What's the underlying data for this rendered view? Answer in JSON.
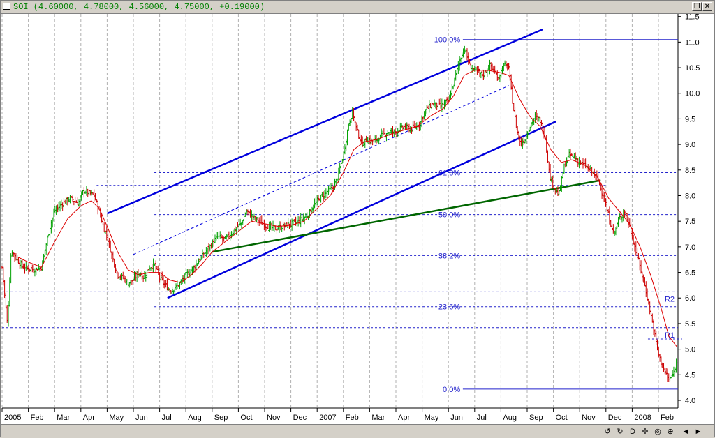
{
  "window": {
    "title": "SOI (4.60000, 4.78000, 4.56000, 4.75000, +0.19000)",
    "buttons": [
      "restore-icon",
      "close-icon"
    ]
  },
  "colors": {
    "price": "#00a000",
    "price_down": "#cc0000",
    "ma": "#dd0000",
    "channel": "#0000dd",
    "trendline": "#006600",
    "fib": "#2222cc",
    "grid": "#b0b0b0"
  },
  "navbar": {
    "buttons": [
      "scroll-left-end-icon",
      "zoom-out-icon",
      "date-mode-icon",
      "pan-icon",
      "zoom-reset-icon",
      "zoom-in-icon",
      "scroll-left-icon",
      "scroll-right-icon"
    ],
    "glyphs": [
      "↺",
      "↻",
      "D",
      "✛",
      "◎",
      "⊕",
      "◄",
      "►"
    ]
  },
  "chart_data": {
    "type": "candlestick",
    "ylim": [
      3.85,
      11.55
    ],
    "yticks": [
      "11.5",
      "11.0",
      "10.5",
      "10.0",
      "9.5",
      "9.0",
      "8.5",
      "8.0",
      "7.5",
      "7.0",
      "6.5",
      "6.0",
      "5.5",
      "5.0",
      "4.5",
      "4.0"
    ],
    "yticks_values": [
      11.5,
      11.0,
      10.5,
      10.0,
      9.5,
      9.0,
      8.5,
      8.0,
      7.5,
      7.0,
      6.5,
      6.0,
      5.5,
      5.0,
      4.5,
      4.0
    ],
    "xticks": [
      "2005",
      "Feb",
      "Mar",
      "Apr",
      "May",
      "Jun",
      "Jul",
      "Aug",
      "Sep",
      "Oct",
      "Nov",
      "Dec",
      "2007",
      "Feb",
      "Mar",
      "Apr",
      "May",
      "Jun",
      "Jul",
      "Aug",
      "Sep",
      "Oct",
      "Nov",
      "Dec",
      "2008",
      "Feb"
    ],
    "xticks_month_index": [
      0,
      1,
      2,
      3,
      4,
      5,
      6,
      7,
      8,
      9,
      10,
      11,
      12,
      13,
      14,
      15,
      16,
      17,
      18,
      19,
      20,
      21,
      22,
      23,
      24,
      25
    ],
    "last_bar": {
      "open": 4.6,
      "high": 4.78,
      "low": 4.56,
      "close": 4.75,
      "change": 0.19
    },
    "price_path": [
      [
        0.0,
        6.6
      ],
      [
        0.2,
        5.5
      ],
      [
        0.35,
        6.95
      ],
      [
        0.5,
        6.8
      ],
      [
        0.8,
        6.6
      ],
      [
        1.2,
        6.55
      ],
      [
        1.5,
        6.6
      ],
      [
        1.8,
        7.35
      ],
      [
        2.0,
        7.7
      ],
      [
        2.3,
        7.85
      ],
      [
        2.6,
        7.95
      ],
      [
        2.9,
        7.85
      ],
      [
        3.1,
        8.1
      ],
      [
        3.3,
        8.05
      ],
      [
        3.5,
        8.0
      ],
      [
        3.7,
        7.7
      ],
      [
        3.85,
        7.4
      ],
      [
        4.0,
        7.2
      ],
      [
        4.2,
        6.8
      ],
      [
        4.4,
        6.45
      ],
      [
        4.6,
        6.4
      ],
      [
        4.8,
        6.3
      ],
      [
        5.0,
        6.35
      ],
      [
        5.2,
        6.5
      ],
      [
        5.4,
        6.4
      ],
      [
        5.6,
        6.6
      ],
      [
        5.8,
        6.65
      ],
      [
        6.0,
        6.4
      ],
      [
        6.2,
        6.25
      ],
      [
        6.4,
        6.15
      ],
      [
        6.6,
        6.2
      ],
      [
        6.8,
        6.3
      ],
      [
        7.0,
        6.45
      ],
      [
        7.3,
        6.6
      ],
      [
        7.6,
        6.8
      ],
      [
        7.9,
        7.0
      ],
      [
        8.2,
        7.2
      ],
      [
        8.5,
        7.15
      ],
      [
        8.8,
        7.3
      ],
      [
        9.1,
        7.45
      ],
      [
        9.3,
        7.7
      ],
      [
        9.5,
        7.6
      ],
      [
        9.8,
        7.5
      ],
      [
        10.1,
        7.4
      ],
      [
        10.4,
        7.35
      ],
      [
        10.7,
        7.4
      ],
      [
        11.0,
        7.45
      ],
      [
        11.3,
        7.5
      ],
      [
        11.6,
        7.6
      ],
      [
        12.0,
        7.9
      ],
      [
        12.3,
        8.05
      ],
      [
        12.6,
        8.15
      ],
      [
        12.8,
        8.4
      ],
      [
        13.0,
        8.8
      ],
      [
        13.2,
        9.4
      ],
      [
        13.35,
        9.65
      ],
      [
        13.5,
        9.3
      ],
      [
        13.7,
        9.0
      ],
      [
        13.9,
        9.1
      ],
      [
        14.1,
        9.05
      ],
      [
        14.4,
        9.15
      ],
      [
        14.7,
        9.25
      ],
      [
        15.0,
        9.25
      ],
      [
        15.3,
        9.35
      ],
      [
        15.6,
        9.3
      ],
      [
        15.9,
        9.4
      ],
      [
        16.1,
        9.65
      ],
      [
        16.4,
        9.8
      ],
      [
        16.7,
        9.75
      ],
      [
        17.0,
        9.85
      ],
      [
        17.2,
        10.2
      ],
      [
        17.4,
        10.6
      ],
      [
        17.6,
        10.9
      ],
      [
        17.8,
        10.55
      ],
      [
        18.0,
        10.45
      ],
      [
        18.3,
        10.35
      ],
      [
        18.6,
        10.55
      ],
      [
        18.9,
        10.3
      ],
      [
        19.1,
        10.55
      ],
      [
        19.3,
        10.5
      ],
      [
        19.45,
        9.8
      ],
      [
        19.6,
        9.3
      ],
      [
        19.75,
        9.0
      ],
      [
        19.9,
        9.1
      ],
      [
        20.1,
        9.35
      ],
      [
        20.3,
        9.55
      ],
      [
        20.5,
        9.45
      ],
      [
        20.7,
        9.1
      ],
      [
        20.85,
        8.4
      ],
      [
        21.0,
        8.2
      ],
      [
        21.2,
        8.0
      ],
      [
        21.4,
        8.55
      ],
      [
        21.6,
        8.8
      ],
      [
        21.8,
        8.75
      ],
      [
        22.0,
        8.65
      ],
      [
        22.3,
        8.55
      ],
      [
        22.5,
        8.45
      ],
      [
        22.7,
        8.3
      ],
      [
        22.9,
        8.0
      ],
      [
        23.1,
        7.6
      ],
      [
        23.3,
        7.25
      ],
      [
        23.5,
        7.55
      ],
      [
        23.7,
        7.7
      ],
      [
        23.9,
        7.4
      ],
      [
        24.1,
        7.0
      ],
      [
        24.3,
        6.6
      ],
      [
        24.5,
        6.2
      ],
      [
        24.7,
        5.7
      ],
      [
        24.85,
        5.3
      ],
      [
        25.0,
        4.9
      ],
      [
        25.2,
        4.6
      ],
      [
        25.4,
        4.4
      ],
      [
        25.55,
        4.5
      ],
      [
        25.7,
        4.75
      ]
    ],
    "ma_path": [
      [
        0.6,
        6.8
      ],
      [
        1.0,
        6.7
      ],
      [
        1.5,
        6.6
      ],
      [
        2.0,
        7.1
      ],
      [
        2.5,
        7.55
      ],
      [
        3.0,
        7.8
      ],
      [
        3.4,
        7.9
      ],
      [
        3.7,
        7.75
      ],
      [
        4.0,
        7.4
      ],
      [
        4.4,
        6.9
      ],
      [
        4.8,
        6.55
      ],
      [
        5.2,
        6.45
      ],
      [
        5.6,
        6.5
      ],
      [
        6.0,
        6.5
      ],
      [
        6.4,
        6.35
      ],
      [
        6.8,
        6.3
      ],
      [
        7.2,
        6.45
      ],
      [
        7.6,
        6.65
      ],
      [
        8.0,
        6.9
      ],
      [
        8.5,
        7.1
      ],
      [
        9.0,
        7.3
      ],
      [
        9.5,
        7.5
      ],
      [
        10.0,
        7.45
      ],
      [
        10.5,
        7.4
      ],
      [
        11.0,
        7.42
      ],
      [
        11.5,
        7.5
      ],
      [
        12.0,
        7.75
      ],
      [
        12.5,
        8.0
      ],
      [
        13.0,
        8.45
      ],
      [
        13.4,
        8.9
      ],
      [
        13.8,
        9.05
      ],
      [
        14.3,
        9.1
      ],
      [
        14.8,
        9.2
      ],
      [
        15.3,
        9.28
      ],
      [
        15.8,
        9.35
      ],
      [
        16.3,
        9.55
      ],
      [
        16.8,
        9.7
      ],
      [
        17.2,
        9.95
      ],
      [
        17.6,
        10.35
      ],
      [
        18.0,
        10.45
      ],
      [
        18.5,
        10.45
      ],
      [
        19.0,
        10.4
      ],
      [
        19.3,
        10.35
      ],
      [
        19.7,
        9.9
      ],
      [
        20.1,
        9.55
      ],
      [
        20.5,
        9.35
      ],
      [
        20.9,
        8.9
      ],
      [
        21.3,
        8.65
      ],
      [
        21.7,
        8.7
      ],
      [
        22.2,
        8.6
      ],
      [
        22.7,
        8.35
      ],
      [
        23.1,
        7.95
      ],
      [
        23.5,
        7.7
      ],
      [
        23.9,
        7.45
      ],
      [
        24.3,
        7.0
      ],
      [
        24.7,
        6.45
      ],
      [
        25.1,
        5.8
      ],
      [
        25.4,
        5.25
      ],
      [
        25.7,
        5.05
      ]
    ],
    "fib_levels": [
      {
        "label": "100.0%",
        "value": 11.05
      },
      {
        "label": "61.8%",
        "value": 8.45
      },
      {
        "label": "50.0%",
        "value": 7.63
      },
      {
        "label": "38.2%",
        "value": 6.83
      },
      {
        "label": "23.6%",
        "value": 5.83
      },
      {
        "label": "0.0%",
        "value": 4.22
      }
    ],
    "sr_levels": [
      {
        "label": "R2",
        "value": 6.12
      },
      {
        "label": "R1",
        "value": 5.42
      },
      {
        "label": "",
        "value": 8.2
      },
      {
        "label": "",
        "value": 5.2
      }
    ],
    "channel_upper": [
      [
        4.0,
        7.65
      ],
      [
        20.6,
        11.25
      ]
    ],
    "channel_lower": [
      [
        6.3,
        6.0
      ],
      [
        21.1,
        9.45
      ]
    ],
    "channel_mid": [
      [
        5.0,
        6.85
      ],
      [
        19.3,
        10.15
      ]
    ],
    "support_trendline": [
      [
        8.0,
        6.9
      ],
      [
        22.8,
        8.3
      ]
    ]
  }
}
